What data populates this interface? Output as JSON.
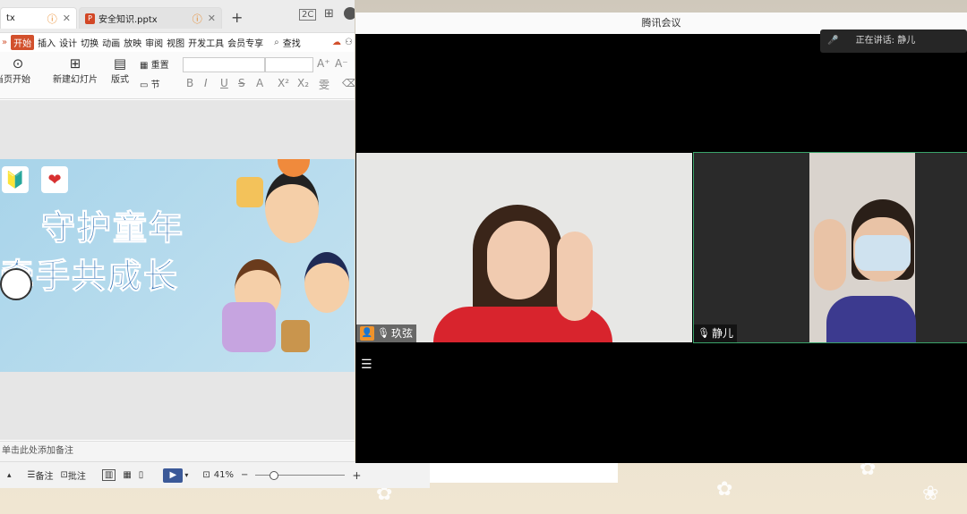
{
  "wps": {
    "tabs": [
      {
        "label": "tx"
      },
      {
        "label": "安全知识.pptx"
      }
    ],
    "menu": [
      "开始",
      "插入",
      "设计",
      "切换",
      "动画",
      "放映",
      "审阅",
      "视图",
      "开发工具",
      "会员专享"
    ],
    "search_label": "查找",
    "ribbon": {
      "from_current": "当页开始",
      "new_slide": "新建幻灯片",
      "layout": "版式",
      "section": "节",
      "reset": "重置"
    },
    "format_buttons": [
      "B",
      "I",
      "U",
      "S",
      "A",
      "X²",
      "X₂"
    ],
    "slide": {
      "title_line1": "守护童年",
      "title_line2": "牵手共成长"
    },
    "notes_placeholder": "单击此处添加备注",
    "status": {
      "notes_label": "备注",
      "comment_label": "批注",
      "zoom": "41%"
    }
  },
  "meeting": {
    "title": "腾讯会议",
    "speaking_label": "正在讲话: 静儿",
    "participants": [
      {
        "name": "玖弦"
      },
      {
        "name": "静儿"
      }
    ]
  }
}
